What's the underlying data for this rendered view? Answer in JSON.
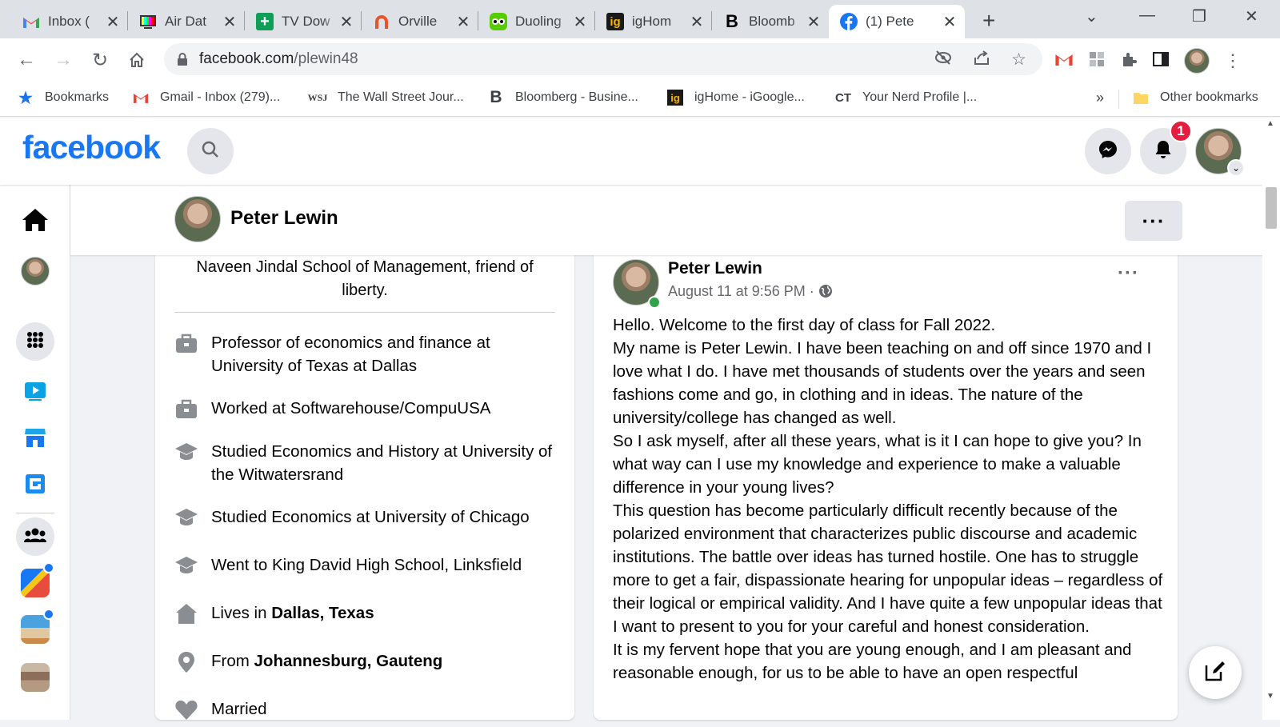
{
  "browser": {
    "tabs": [
      {
        "title": "Inbox (",
        "favicon": "gmail-icon"
      },
      {
        "title": "Air Dat",
        "favicon": "tv-test-icon"
      },
      {
        "title": "TV Dow",
        "favicon": "plus-green-icon"
      },
      {
        "title": "Orville",
        "favicon": "orange-arch-icon"
      },
      {
        "title": "Duoling",
        "favicon": "owl-icon"
      },
      {
        "title": "igHom",
        "favicon": "ig-icon"
      },
      {
        "title": "Bloomb",
        "favicon": "bloomberg-b-icon"
      },
      {
        "title": "(1) Pete",
        "favicon": "facebook-icon",
        "active": true
      }
    ],
    "url_host": "facebook.com",
    "url_path": "/plewin48",
    "bookmarks": [
      {
        "label": "Bookmarks",
        "icon": "star-icon"
      },
      {
        "label": "Gmail - Inbox (279)...",
        "icon": "gmail-icon"
      },
      {
        "label": "The Wall Street Jour...",
        "icon": "wsj-icon"
      },
      {
        "label": "Bloomberg - Busine...",
        "icon": "bloomberg-b-icon"
      },
      {
        "label": "igHome - iGoogle...",
        "icon": "ig-icon"
      },
      {
        "label": "Your Nerd Profile |...",
        "icon": "ct-icon"
      }
    ],
    "bookmarks_overflow": "»",
    "other_bookmarks": "Other bookmarks",
    "fav_letters": {
      "bloomberg": "B",
      "ig": "ig",
      "wsj": "WSJ",
      "ct": "CT"
    }
  },
  "facebook": {
    "logo": "facebook",
    "notification_count": "1",
    "brand_color": "#1877f2",
    "profile_name": "Peter Lewin",
    "intro": {
      "bio": "Naveen Jindal School of Management, friend of liberty.",
      "rows": [
        {
          "icon": "briefcase-icon",
          "text": "Professor of economics and finance at University of Texas at Dallas"
        },
        {
          "icon": "briefcase-icon",
          "text": "Worked at Softwarehouse/CompuUSA"
        },
        {
          "icon": "graduation-cap-icon",
          "text": "Studied Economics and History at University of the Witwatersrand"
        },
        {
          "icon": "graduation-cap-icon",
          "text": "Studied Economics at University of Chicago"
        },
        {
          "icon": "graduation-cap-icon",
          "text": "Went to King David High School, Linksfield"
        },
        {
          "icon": "home-icon",
          "prefix": "Lives in ",
          "bold": "Dallas, Texas"
        },
        {
          "icon": "location-pin-icon",
          "prefix": "From ",
          "bold": "Johannesburg, Gauteng"
        },
        {
          "icon": "heart-icon",
          "text": "Married"
        }
      ]
    },
    "post": {
      "author": "Peter Lewin",
      "date": "August 11 at 9:56 PM · ",
      "paragraphs": [
        "Hello. Welcome to the first day of class for Fall 2022.",
        "My name is Peter Lewin. I have been teaching on and off since 1970 and I love what I do. I have met thousands of students over the years and seen fashions come and go, in clothing and in ideas. The nature of the university/college has changed as well.",
        "So I ask myself, after all these years, what is it I can hope to give you? In what way can I use my knowledge and experience to make a valuable difference in your young lives?",
        "This question has become particularly difficult recently because of the polarized environment that characterizes public discourse and academic institutions. The battle over ideas has turned hostile. One has to struggle more to get a fair, dispassionate hearing for unpopular ideas – regardless of their logical or empirical validity. And I have quite a few unpopular ideas that I want to present to you for your careful and honest consideration.",
        "It is my fervent hope that you are young enough, and I am pleasant and reasonable enough, for us to be able to have an open respectful"
      ]
    }
  }
}
